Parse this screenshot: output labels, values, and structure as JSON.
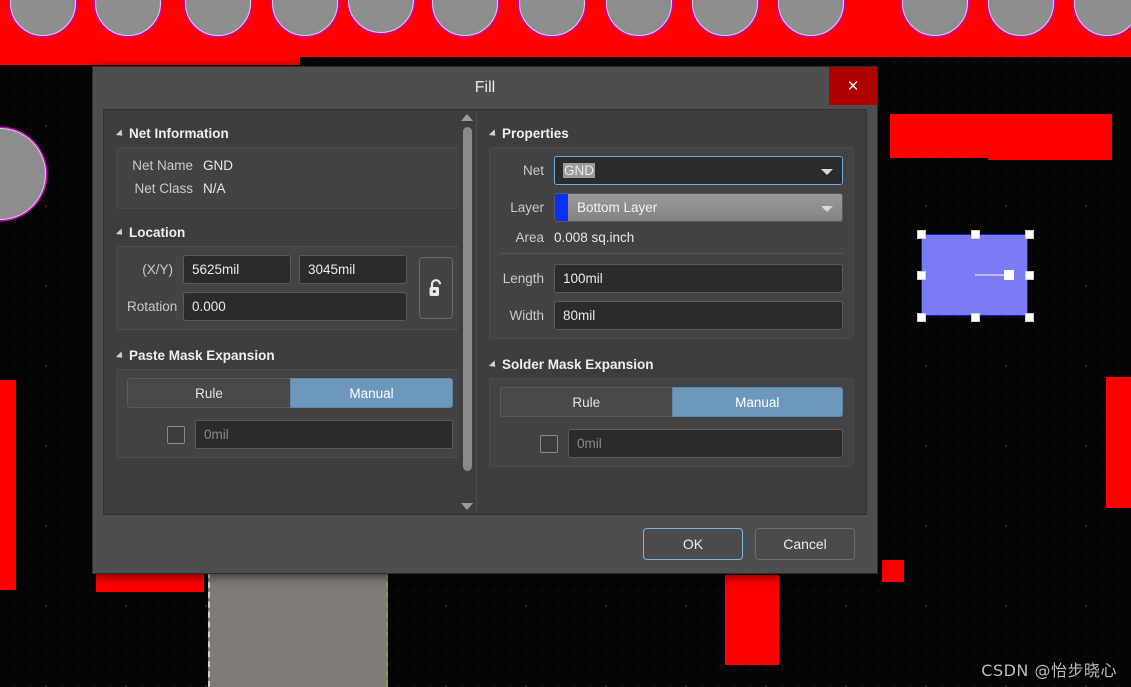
{
  "dialog": {
    "title": "Fill",
    "close_label": "×",
    "footer": {
      "ok_label": "OK",
      "cancel_label": "Cancel"
    }
  },
  "net_information": {
    "header": "Net Information",
    "rows": [
      {
        "label": "Net Name",
        "value": "GND"
      },
      {
        "label": "Net Class",
        "value": "N/A"
      }
    ]
  },
  "location": {
    "header": "Location",
    "xy_label": "(X/Y)",
    "x_value": "5625mil",
    "y_value": "3045mil",
    "rotation_label": "Rotation",
    "rotation_value": "0.000",
    "lock_icon": "unlocked-padlock-icon"
  },
  "paste_mask_expansion": {
    "header": "Paste Mask Expansion",
    "rule_label": "Rule",
    "manual_label": "Manual",
    "selected_mode": "Manual",
    "value_placeholder": "0mil",
    "checkbox_checked": false
  },
  "properties": {
    "header": "Properties",
    "net_label": "Net",
    "net_value": "GND",
    "layer_label": "Layer",
    "layer_value": "Bottom Layer",
    "layer_color": "#0b2ff5",
    "area_label": "Area",
    "area_value": "0.008 sq.inch",
    "length_label": "Length",
    "length_value": "100mil",
    "width_label": "Width",
    "width_value": "80mil"
  },
  "solder_mask_expansion": {
    "header": "Solder Mask Expansion",
    "rule_label": "Rule",
    "manual_label": "Manual",
    "selected_mode": "Manual",
    "value_placeholder": "0mil",
    "checkbox_checked": false
  },
  "watermark": {
    "text": "CSDN @怡步晓心"
  },
  "canvas": {
    "copper_color": "#fe0000",
    "pad_color": "#8d8d8d",
    "pad_outline_color": "#c600c6",
    "selected_fill_color": "#7b7bf5",
    "background_color": "#050505"
  }
}
